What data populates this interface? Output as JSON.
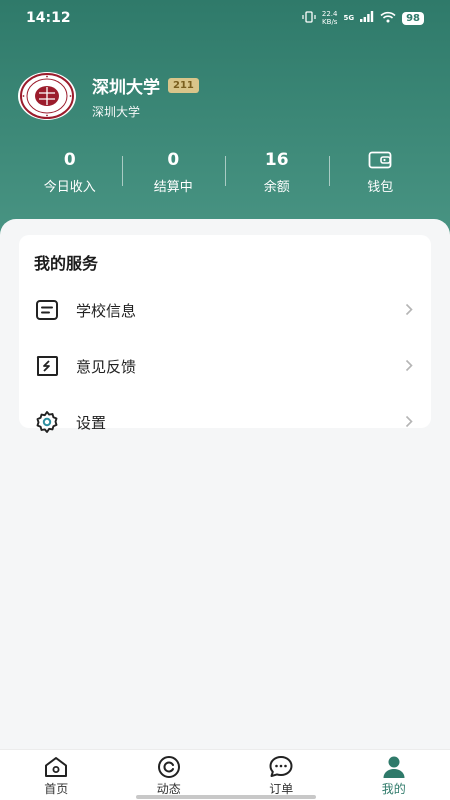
{
  "status_bar": {
    "time": "14:12",
    "net_speed_value": "22.4",
    "net_speed_unit": "KB/s",
    "signal_type": "5G",
    "battery": "98"
  },
  "profile": {
    "name": "深圳大学",
    "badge": "211",
    "subtitle": "深圳大学",
    "logo_icon": "university-seal-icon"
  },
  "stats": [
    {
      "value": "0",
      "label": "今日收入"
    },
    {
      "value": "0",
      "label": "结算中"
    },
    {
      "value": "16",
      "label": "余额"
    },
    {
      "icon": "wallet-icon",
      "label": "钱包"
    }
  ],
  "services": {
    "title": "我的服务",
    "items": [
      {
        "label": "学校信息",
        "icon": "document-icon"
      },
      {
        "label": "意见反馈",
        "icon": "feedback-icon"
      },
      {
        "label": "设置",
        "icon": "gear-icon"
      }
    ]
  },
  "tabbar": {
    "active": "我的",
    "tabs": [
      {
        "label": "首页",
        "icon": "home-icon"
      },
      {
        "label": "动态",
        "icon": "activity-icon"
      },
      {
        "label": "订单",
        "icon": "chat-bubble-icon"
      },
      {
        "label": "我的",
        "icon": "person-icon"
      }
    ]
  },
  "colors": {
    "accent": "#2f7a6a",
    "header_gradient_top": "#2f7a6a",
    "badge_bg": "#d9c58a",
    "seal_red": "#9b1c2c"
  }
}
